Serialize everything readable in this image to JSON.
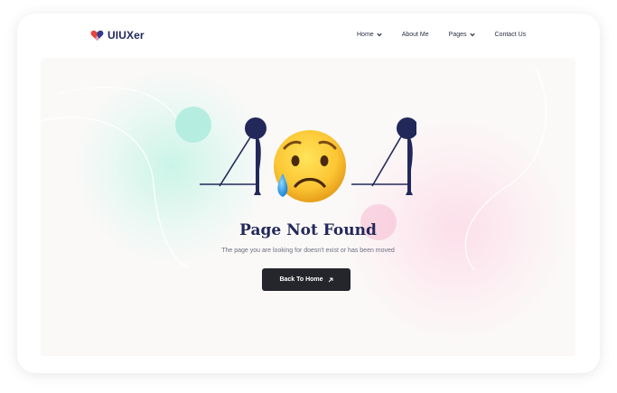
{
  "brand": {
    "name": "UIUXer"
  },
  "nav": {
    "items": [
      {
        "label": "Home",
        "has_dropdown": true
      },
      {
        "label": "About Me",
        "has_dropdown": false
      },
      {
        "label": "Pages",
        "has_dropdown": true
      },
      {
        "label": "Contact Us",
        "has_dropdown": false
      }
    ]
  },
  "error": {
    "code": "404",
    "title": "Page Not Found",
    "message": "The page you are looking for doesn't exist or has been moved",
    "cta_label": "Back To Home",
    "emoji": "sad-but-relieved-face"
  },
  "colors": {
    "navy": "#23285a",
    "button": "#25262b",
    "teal_accent": "#b5eee0",
    "pink_accent": "#f8c6d8",
    "logo_red": "#e8453c",
    "logo_blue": "#2f3b8f"
  }
}
